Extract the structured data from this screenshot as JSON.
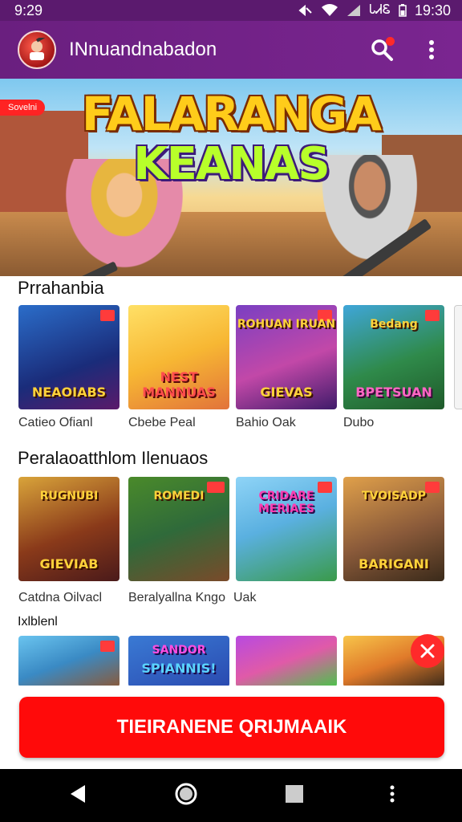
{
  "status_bar": {
    "time_left": "9:29",
    "carrier": "ᏓᏗᏋ",
    "time_right": "19:30"
  },
  "app_bar": {
    "title": "INnuandnabadon"
  },
  "hero": {
    "badge": "Sovelni",
    "title_line1": "FALARANGA",
    "title_line2": "KEANAS"
  },
  "sections": [
    {
      "title": "Prrahanbia",
      "items": [
        {
          "caption": "Catieo Ofianl",
          "art_text": "NEAOIABS",
          "top_text": ""
        },
        {
          "caption": "Cbebe Peal",
          "art_text": "NEST MANNUAS",
          "top_text": ""
        },
        {
          "caption": "Bahio Oak",
          "art_text": "GIEVAS",
          "top_text": "ROHUAN IRUAN"
        },
        {
          "caption": "Dubo",
          "art_text": "BPETSUAN",
          "top_text": "Bedang"
        }
      ]
    },
    {
      "title": "Peralaoatthlom Ilenuaos",
      "items": [
        {
          "caption": "Catdna Oilvacl",
          "art_text": "GIEVIAB",
          "top_text": "RUGNUBI"
        },
        {
          "caption": "Beralyallna Kngo",
          "art_text": "",
          "top_text": "ROMEDI"
        },
        {
          "caption": "Uak",
          "art_text": "",
          "top_text": "CRIDARE MERIAES"
        },
        {
          "caption": "",
          "art_text": "BARIGANI",
          "top_text": "TVOISADP"
        }
      ]
    },
    {
      "title": "Ixlblenl",
      "items": [
        {
          "caption": "",
          "art_text": "",
          "top_text": ""
        },
        {
          "caption": "",
          "art_text": "SPIANNIS!",
          "top_text": "SANDOR"
        },
        {
          "caption": "",
          "art_text": "",
          "top_text": ""
        },
        {
          "caption": "",
          "art_text": "",
          "top_text": ""
        }
      ]
    }
  ],
  "cta": {
    "label": "TIEIRANENE QRIJMAAIK"
  },
  "colors": {
    "primary": "#6a1f7f",
    "accent": "#ff0a0a"
  },
  "icons": [
    "search-icon",
    "more-vert-icon",
    "back-icon",
    "home-icon",
    "recents-icon"
  ]
}
